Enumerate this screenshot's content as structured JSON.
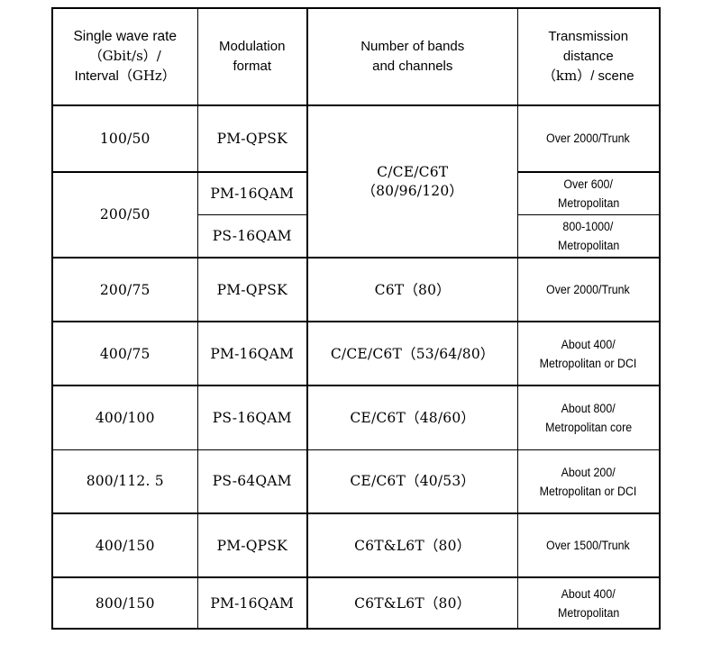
{
  "table": {
    "headers": [
      {
        "id": "single-wave-rate",
        "line1": "Single wave rate",
        "line2": "（Gbit/s）/",
        "line3_en": "Interval",
        "line3_unit": "（GHz）"
      },
      {
        "id": "modulation-format",
        "line1": "Modulation",
        "line2": "format"
      },
      {
        "id": "number-of-bands-and-channels",
        "line1": "Number of bands",
        "line2": "and channels"
      },
      {
        "id": "transmission-distance",
        "line1": "Transmission",
        "line2": "distance",
        "line3_unit": "（km）",
        "line3_en": "/ scene"
      }
    ],
    "rows": [
      {
        "rate": "100/50",
        "modulation": "PM-QPSK",
        "bands": "C/CE/C6T\n（80/96/120）",
        "bands_line1": "C/CE/C6T",
        "bands_line2": "（80/96/120）",
        "distance_line1": "Over 2000/Trunk",
        "distance_line2": ""
      },
      {
        "rate": "200/50",
        "modulation": "PM-16QAM",
        "distance_line1": "Over 600/",
        "distance_line2": "Metropolitan"
      },
      {
        "rate": "",
        "modulation": "PS-16QAM",
        "distance_line1": "800-1000/",
        "distance_line2": "Metropolitan"
      },
      {
        "rate": "200/75",
        "modulation": "PM-QPSK",
        "bands": "C6T（80）",
        "distance_line1": "Over 2000/Trunk",
        "distance_line2": ""
      },
      {
        "rate": "400/75",
        "modulation": "PM-16QAM",
        "bands": "C/CE/C6T（53/64/80）",
        "distance_line1": "About 400/",
        "distance_line2": "Metropolitan or DCI"
      },
      {
        "rate": "400/100",
        "modulation": "PS-16QAM",
        "bands": "CE/C6T（48/60）",
        "distance_line1": "About 800/",
        "distance_line2": "Metropolitan core"
      },
      {
        "rate": "800/112. 5",
        "modulation": "PS-64QAM",
        "bands": "CE/C6T（40/53）",
        "distance_line1": "About 200/",
        "distance_line2": "Metropolitan or DCI"
      },
      {
        "rate": "400/150",
        "modulation": "PM-QPSK",
        "bands": "C6T&L6T（80）",
        "distance_line1": "Over 1500/Trunk",
        "distance_line2": ""
      },
      {
        "rate": "800/150",
        "modulation": "PM-16QAM",
        "bands": "C6T&L6T（80）",
        "distance_line1": "About 400/",
        "distance_line2": "Metropolitan"
      }
    ]
  }
}
